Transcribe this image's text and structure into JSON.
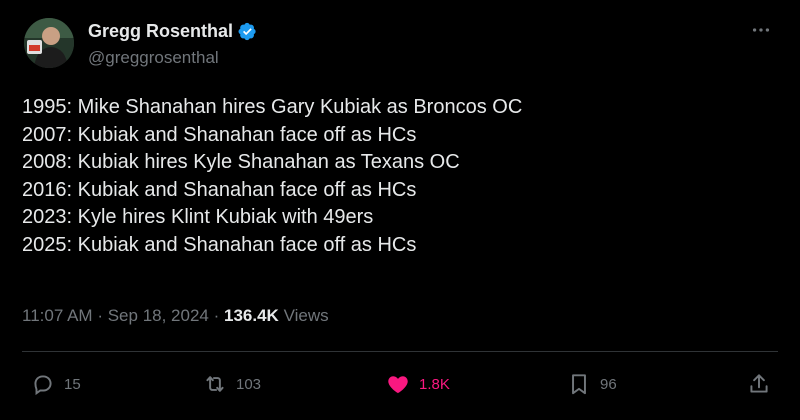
{
  "author": {
    "display_name": "Gregg Rosenthal",
    "handle": "@greggrosenthal",
    "verified_color": "#1d9bf0"
  },
  "tweet": {
    "lines": [
      "1995: Mike Shanahan hires Gary Kubiak as Broncos OC",
      "2007: Kubiak and Shanahan face off as HCs",
      "2008: Kubiak hires Kyle Shanahan as Texans OC",
      "2016: Kubiak and Shanahan face off as HCs",
      "2023: Kyle hires Klint Kubiak with 49ers",
      "2025: Kubiak and Shanahan face off as HCs"
    ],
    "time": "11:07 AM",
    "separator": "·",
    "date": "Sep 18, 2024",
    "views_count": "136.4K",
    "views_label": "Views"
  },
  "actions": {
    "replies": "15",
    "retweets": "103",
    "likes": "1.8K",
    "bookmarks": "96"
  },
  "colors": {
    "background": "#000000",
    "text": "#e7e9ea",
    "muted": "#71767b",
    "like_active": "#f91880",
    "divider": "#2f3336"
  },
  "icons": {
    "more": "more-icon",
    "reply": "reply-icon",
    "retweet": "retweet-icon",
    "like": "heart-icon",
    "bookmark": "bookmark-icon",
    "share": "share-icon"
  }
}
